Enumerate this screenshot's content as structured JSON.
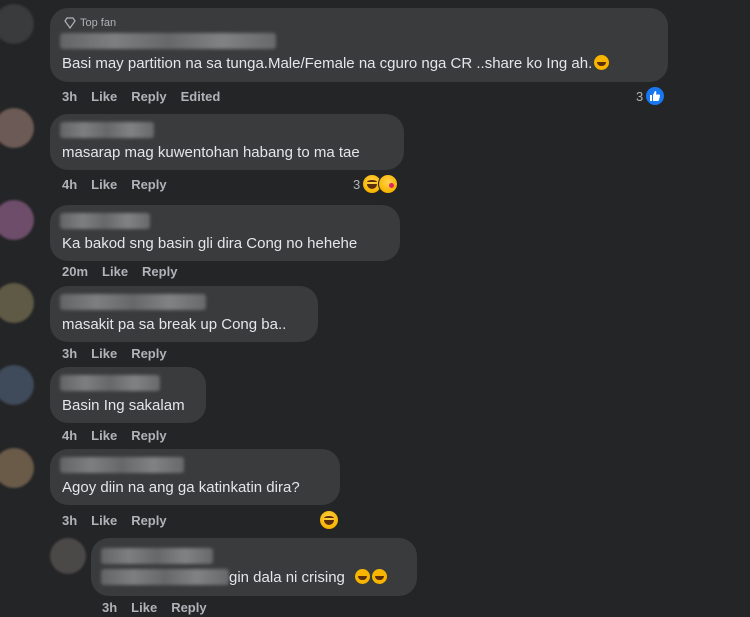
{
  "comments": [
    {
      "badge": "Top fan",
      "text": "Basi may partition na sa tunga.Male/Female na cguro nga CR ..share ko Ing ah.",
      "time": "3h",
      "like": "Like",
      "reply": "Reply",
      "edited": "Edited",
      "reaction_count": "3"
    },
    {
      "text": "masarap mag kuwentohan habang to ma tae",
      "time": "4h",
      "like": "Like",
      "reply": "Reply",
      "reaction_count": "3"
    },
    {
      "text": "Ka bakod sng basin gli dira Cong no hehehe",
      "time": "20m",
      "like": "Like",
      "reply": "Reply"
    },
    {
      "text": "masakit pa sa break up Cong ba..",
      "time": "3h",
      "like": "Like",
      "reply": "Reply"
    },
    {
      "text": "Basin Ing sakalam",
      "time": "4h",
      "like": "Like",
      "reply": "Reply"
    },
    {
      "text": "Agoy diin na ang ga katinkatin dira?",
      "time": "3h",
      "like": "Like",
      "reply": "Reply"
    }
  ],
  "reply": {
    "text": "gin dala ni crising",
    "time": "3h",
    "like": "Like",
    "reply": "Reply"
  },
  "colors": {
    "background": "#242526",
    "bubble": "#3a3b3c",
    "text": "#e4e6eb",
    "meta": "#b0b3b8",
    "like_blue": "#1877f2"
  }
}
